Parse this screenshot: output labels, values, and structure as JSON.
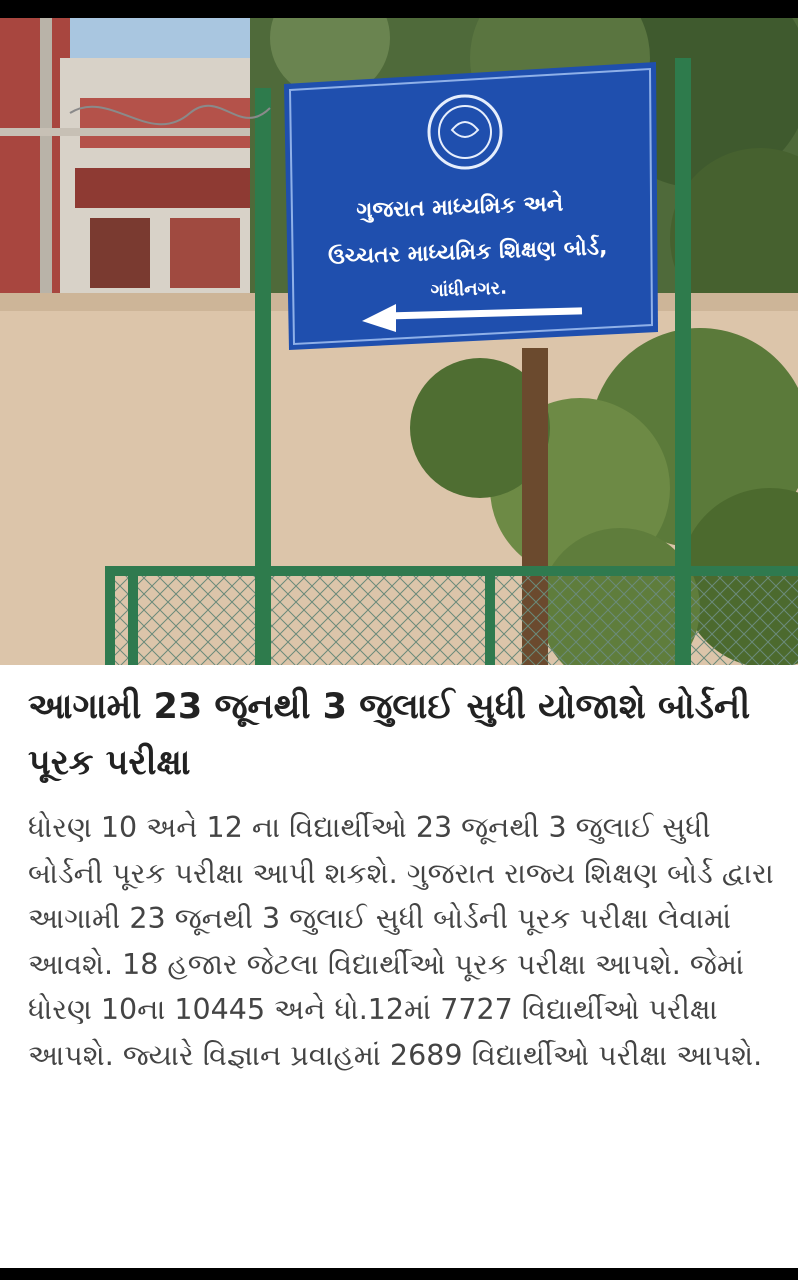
{
  "photo": {
    "sign": {
      "line1": "ગુજરાત માધ્યમિક અને",
      "line2": "ઉચ્ચતર માધ્યમિક શિક્ષણ બોર્ડ,",
      "line3": "ગાંધીનગર.",
      "arrow_icon": "arrow-left-icon",
      "background_color": "#1f4fae"
    }
  },
  "article": {
    "headline": "આગામી 23 જૂનથી 3 જુલાઈ સુધી યોજાશે બોર્ડની પૂરક પરીક્ષા",
    "body": "ધોરણ 10 અને 12 ના વિદ્યાર્થીઓ 23 જૂનથી 3 જુલાઈ સુધી બોર્ડની પૂરક પરીક્ષા આપી શકશે. ગુજરાત રાજ્ય શિક્ષણ બોર્ડ દ્વારા આગામી 23 જૂનથી 3 જુલાઈ સુધી બોર્ડની પૂરક પરીક્ષા લેવામાં આવશે. 18 હજાર જેટલા વિદ્યાર્થીઓ પૂરક પરીક્ષા આપશે. જેમાં ધોરણ 10ના 10445 અને ધો.12માં 7727 વિદ્યાર્થીઓ પરીક્ષા આપશે. જ્યારે વિજ્ઞાન પ્રવાહમાં 2689 વિદ્યાર્થીઓ પરીક્ષા આપશે."
  }
}
